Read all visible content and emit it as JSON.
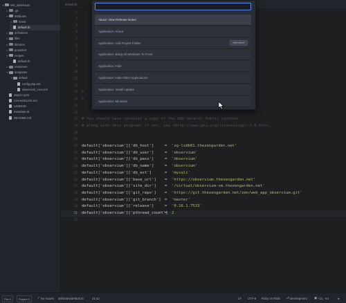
{
  "sidebar": {
    "items": [
      {
        "label": "ssh_observium",
        "type": "folder-open",
        "depth": 0
      },
      {
        "label": ".git",
        "type": "folder",
        "depth": 1
      },
      {
        "label": "attributes",
        "type": "folder-open",
        "depth": 1
      },
      {
        "label": "forest",
        "type": "folder",
        "depth": 2
      },
      {
        "label": "default.rb",
        "type": "file",
        "depth": 2
      },
      {
        "label": "definitions",
        "type": "folder",
        "depth": 1
      },
      {
        "label": "files",
        "type": "folder",
        "depth": 1
      },
      {
        "label": "libraries",
        "type": "folder",
        "depth": 1
      },
      {
        "label": "providers",
        "type": "folder",
        "depth": 1
      },
      {
        "label": "recipes",
        "type": "folder-open",
        "depth": 1
      },
      {
        "label": "default.rb",
        "type": "file",
        "depth": 2
      },
      {
        "label": "resources",
        "type": "folder",
        "depth": 1
      },
      {
        "label": "templates",
        "type": "folder-open",
        "depth": 1
      },
      {
        "label": "default",
        "type": "folder-open",
        "depth": 2
      },
      {
        "label": "config.php.erb",
        "type": "file",
        "depth": 3
      },
      {
        "label": "observium_cron.erb",
        "type": "file",
        "depth": 3
      },
      {
        "label": "attach-r.pml",
        "type": "file",
        "depth": 1
      },
      {
        "label": "CHANGELOG.md",
        "type": "file",
        "depth": 1
      },
      {
        "label": "LICENSE",
        "type": "file",
        "depth": 1
      },
      {
        "label": "metadata.rb",
        "type": "file",
        "depth": 1
      },
      {
        "label": "README.md",
        "type": "file",
        "depth": 1
      }
    ]
  },
  "tabs": [
    {
      "label": "default.rb"
    }
  ],
  "palette": {
    "query": "",
    "placeholder": "",
    "items": [
      {
        "label": "About: View Release Notes",
        "keybinding": "",
        "selected": true
      },
      {
        "label": "Application: About",
        "keybinding": ""
      },
      {
        "label": "Application: Add Project Folder",
        "keybinding": "Ctrl+Alt+O"
      },
      {
        "label": "Application: Bring All Windows To Front",
        "keybinding": ""
      },
      {
        "label": "Application: Hide",
        "keybinding": ""
      },
      {
        "label": "Application: Hide Other Applications",
        "keybinding": ""
      },
      {
        "label": "Application: Install Update",
        "keybinding": ""
      },
      {
        "label": "Application: Minimize",
        "keybinding": ""
      }
    ]
  },
  "editor": {
    "hidden_line_numbers": [
      "1",
      "2",
      "3",
      "4",
      "5",
      "6",
      "7",
      "8",
      "9",
      "10",
      "11",
      "12",
      "13",
      "14",
      "15",
      "16",
      "17",
      "18",
      "19",
      "20"
    ],
    "dim_lines": [
      {
        "line": 13,
        "text": "#"
      },
      {
        "line": 14,
        "text": "#"
      }
    ],
    "comments": [
      {
        "line": 17,
        "text": "# You should have received a copy of the GNU General Public License"
      },
      {
        "line": 18,
        "text": "# along with this program; if not, see <http://www.gnu.org/licenses/gpl-3.0.txt>."
      }
    ],
    "code": [
      {
        "line": "21",
        "key": "default['observium']['db_host']",
        "value": "'zg-lxdb01.thezengarden.net'"
      },
      {
        "line": "22",
        "key": "default['observium']['db_user']",
        "value": "'observium'"
      },
      {
        "line": "23",
        "key": "default['observium']['db_pass']",
        "value": "'observium'"
      },
      {
        "line": "24",
        "key": "default['observium']['db_name']",
        "value": "'observium'"
      },
      {
        "line": "25",
        "key": "default['observium']['db_ext']",
        "value": "'mysqli'"
      },
      {
        "line": "26",
        "key": "default['observium']['base_url']",
        "value": "'https://observium.thezengarden.net'"
      },
      {
        "line": "27",
        "key": "default['observium']['site_dir']",
        "value": "'/virtual/observium-vm.thezengarden.net'"
      },
      {
        "line": "28",
        "key": "default['observium']['git_repo']",
        "value": "'https://git.thezengarden.net/zen/web_app_observium.git'"
      },
      {
        "line": "29",
        "key": "default['observium']['git_branch']",
        "value": "'master'"
      },
      {
        "line": "30",
        "key": "default['observium']['release']",
        "value": "'0.16.1.7533'"
      },
      {
        "line": "31",
        "key": "default['observium']['pthread_count']",
        "value": "2"
      },
      {
        "line": "32",
        "key": "",
        "value": ""
      }
    ],
    "active_line": "31"
  },
  "statusbar": {
    "file_tile": "File 0",
    "project_tile": "Project 0",
    "issues": "No Issues",
    "path": "attributes/default.rb",
    "cursor": "31:42",
    "line_ending": "LF",
    "encoding": "UTF-8",
    "grammar": "Ruby on Rails",
    "branch": "development",
    "diff": "+11, -44"
  },
  "colors": {
    "accent": "#568af2",
    "string": "#b5bd68",
    "comment": "#4d5159",
    "background": "#1d1f21"
  }
}
